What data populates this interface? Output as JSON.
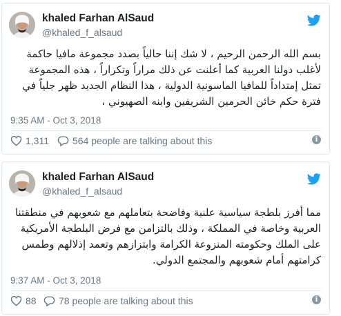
{
  "brand": {
    "twitter_blue": "#1da1f2",
    "text_dark": "#1c2022",
    "text_muted": "#697882"
  },
  "tweets": [
    {
      "name": "khaled Farhan AlSaud",
      "handle": "@khaled_f_alsaud",
      "text": "بسم الله الرحمن الرحيم ، لا شك إننا حالياً بصدد مجموعة مافيا حاكمة لأغلب دولنا العربية كما أعلنت عن ذلك مراراً وتكراراً ، هذه المجموعة تمثل إمتداداً للمافيا الماسونية الدولية ، هذا النظام الجديد ظهر جلياً في فترة حكم خائن الحرمين الشريفين وابنه الصهيوني ،",
      "timestamp": "9:35 AM - Oct 3, 2018",
      "likes": "1,311",
      "talking": "564 people are talking about this",
      "icons": {
        "like": "heart-icon",
        "reply": "speech-bubble-icon",
        "info": "info-icon",
        "logo": "twitter-bird-icon"
      }
    },
    {
      "name": "khaled Farhan AlSaud",
      "handle": "@khaled_f_alsaud",
      "text": "مما أفرز بلطجة سياسية علنية وفاضحة بتعاملهم مع شعوبهم في منطقتنا العربية وخاصة في المملكة ، وذلك بالتزامن مع فرض البلطجة الأمريكية على الملك وحكومته المنزوعة الكرامة وابتزازهم وتعمد إذلالهم وطمس كرامتهم أمام شعوبهم والمجتمع الدولي.",
      "timestamp": "9:37 AM - Oct 3, 2018",
      "likes": "88",
      "talking": "78 people are talking about this",
      "icons": {
        "like": "heart-icon",
        "reply": "speech-bubble-icon",
        "info": "info-icon",
        "logo": "twitter-bird-icon"
      }
    }
  ]
}
